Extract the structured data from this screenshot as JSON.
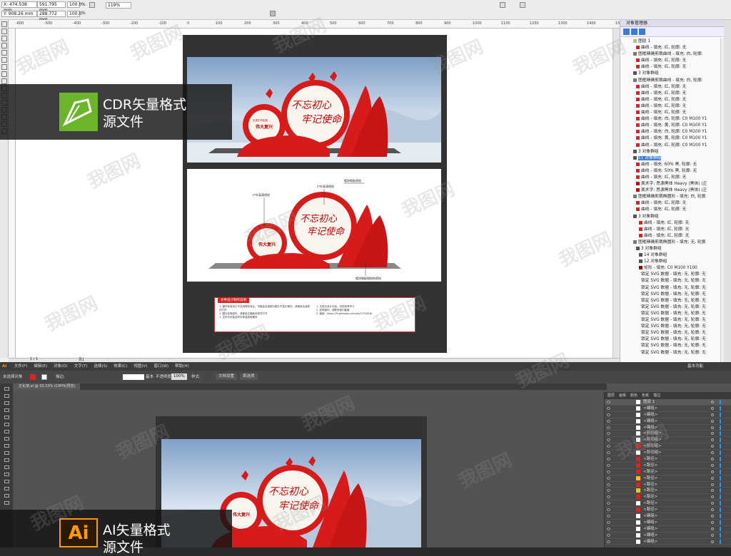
{
  "cdr": {
    "prop_x": "X: 474.538 mm",
    "prop_y": "Y: 908.26 mm",
    "prop_w": "591.795 mm",
    "prop_h": "288.772 mm",
    "scale_w": "100.0",
    "scale_h": "100.0",
    "percent": "%",
    "zoom": "119%",
    "ruler_marks": [
      "-600",
      "-500",
      "-400",
      "-300",
      "-200",
      "-100",
      "0",
      "100",
      "200",
      "300",
      "400",
      "500",
      "600",
      "700",
      "800",
      "900",
      "1000",
      "1100",
      "1200",
      "1300",
      "1400",
      "1500"
    ],
    "page_counter": "1 / 1",
    "page_tab": "页1"
  },
  "obj_panel": {
    "title": "对象管理器",
    "rows": [
      {
        "indent": 4,
        "icon": "folder",
        "text": "图层 1",
        "sel": false
      },
      {
        "indent": 5,
        "icon": "curve",
        "text": "曲线 - 填充: 红, 轮廓: 无",
        "sel": false
      },
      {
        "indent": 4,
        "icon": "clip",
        "text": "图框精确剪裁曲线 - 填充: 白, 轮廓:",
        "sel": false
      },
      {
        "indent": 5,
        "icon": "curve",
        "text": "曲线 - 填充: 红, 轮廓: 无",
        "sel": false
      },
      {
        "indent": 5,
        "icon": "curve",
        "text": "曲线 - 填充: 红, 轮廓: 无",
        "sel": false
      },
      {
        "indent": 4,
        "icon": "group",
        "text": "3 对象群组",
        "sel": false
      },
      {
        "indent": 4,
        "icon": "clip",
        "text": "图框精确剪裁曲线 - 填充: 白, 轮廓:",
        "sel": false
      },
      {
        "indent": 5,
        "icon": "curve",
        "text": "曲线 - 填充: 红, 轮廓: 无",
        "sel": false
      },
      {
        "indent": 5,
        "icon": "curve",
        "text": "曲线 - 填充: 红, 轮廓: 无",
        "sel": false
      },
      {
        "indent": 5,
        "icon": "curve",
        "text": "曲线 - 填充: 红, 轮廓: 无",
        "sel": false
      },
      {
        "indent": 5,
        "icon": "curve",
        "text": "曲线 - 填充: 红, 轮廓: 无",
        "sel": false
      },
      {
        "indent": 5,
        "icon": "curve",
        "text": "曲线 - 填充: 红, 轮廓: 无",
        "sel": false
      },
      {
        "indent": 5,
        "icon": "curve",
        "text": "曲线 - 填充: 白, 轮廓: C0 M100 Y1",
        "sel": false
      },
      {
        "indent": 5,
        "icon": "curve",
        "text": "曲线 - 填充: 黄, 轮廓: C0 M100 Y1",
        "sel": false
      },
      {
        "indent": 5,
        "icon": "curve",
        "text": "曲线 - 填充: 白, 轮廓: C0 M100 Y1",
        "sel": false
      },
      {
        "indent": 5,
        "icon": "curve",
        "text": "曲线 - 填充: 黄, 轮廓: C0 M100 Y1",
        "sel": false
      },
      {
        "indent": 5,
        "icon": "curve",
        "text": "曲线 - 填充: 红, 轮廓: C0 M100 Y1",
        "sel": false
      },
      {
        "indent": 4,
        "icon": "group",
        "text": "3 对象群组",
        "sel": false
      },
      {
        "indent": 4,
        "icon": "group",
        "text": "11 对象群组",
        "sel": true
      },
      {
        "indent": 5,
        "icon": "curve",
        "text": "曲线 - 填充: 60% 黑, 轮廓: 无",
        "sel": false
      },
      {
        "indent": 5,
        "icon": "curve",
        "text": "曲线 - 填充: 50% 黑, 轮廓: 无",
        "sel": false
      },
      {
        "indent": 5,
        "icon": "curve",
        "text": "曲线 - 填充: 红, 轮廓: 无",
        "sel": false
      },
      {
        "indent": 5,
        "icon": "text",
        "text": "美术字: 思源黑体 Heavy (黑体) (正",
        "sel": false
      },
      {
        "indent": 5,
        "icon": "text",
        "text": "美术字: 思源黑体 Heavy (黑体) (正",
        "sel": false
      },
      {
        "indent": 4,
        "icon": "clip",
        "text": "图框精确剪裁椭圆形 - 填充: 白, 轮廓",
        "sel": false
      },
      {
        "indent": 5,
        "icon": "curve",
        "text": "曲线 - 填充: 红, 轮廓: 无",
        "sel": false
      },
      {
        "indent": 5,
        "icon": "curve",
        "text": "曲线 - 填充: 红, 轮廓: 无",
        "sel": false
      },
      {
        "indent": 4,
        "icon": "group",
        "text": "3 对象群组",
        "sel": false
      },
      {
        "indent": 6,
        "icon": "curve",
        "text": "曲线 - 填充: 红, 轮廓: 无",
        "sel": false
      },
      {
        "indent": 6,
        "icon": "curve",
        "text": "曲线 - 填充: 红, 轮廓: 无",
        "sel": false
      },
      {
        "indent": 6,
        "icon": "curve",
        "text": "曲线 - 填充: 红, 轮廓: 无",
        "sel": false
      },
      {
        "indent": 4,
        "icon": "clip",
        "text": "图框精确剪裁椭圆形 - 填充: 无, 轮廓",
        "sel": false
      },
      {
        "indent": 5,
        "icon": "group",
        "text": "3 对象群组",
        "sel": false
      },
      {
        "indent": 6,
        "icon": "group",
        "text": "14 对象群组",
        "sel": false
      },
      {
        "indent": 6,
        "icon": "group",
        "text": "12 对象群组",
        "sel": false
      },
      {
        "indent": 6,
        "icon": "rect",
        "text": "矩形 - 填充: C0 M100 Y100",
        "sel": false
      },
      {
        "indent": 5,
        "icon": "none",
        "text": "锁定 SVG 数据 - 填充: 无, 轮廓: 无",
        "sel": false
      },
      {
        "indent": 5,
        "icon": "none",
        "text": "锁定 SVG 数据 - 填充: 无, 轮廓: 无",
        "sel": false
      },
      {
        "indent": 5,
        "icon": "none",
        "text": "锁定 SVG 数据 - 填充: 无, 轮廓: 无",
        "sel": false
      },
      {
        "indent": 5,
        "icon": "none",
        "text": "锁定 SVG 数据 - 填充: 无, 轮廓: 无",
        "sel": false
      },
      {
        "indent": 5,
        "icon": "none",
        "text": "锁定 SVG 数据 - 填充: 无, 轮廓: 无",
        "sel": false
      },
      {
        "indent": 5,
        "icon": "none",
        "text": "锁定 SVG 数据 - 填充: 无, 轮廓: 无",
        "sel": false
      },
      {
        "indent": 5,
        "icon": "none",
        "text": "锁定 SVG 数据 - 填充: 无, 轮廓: 无",
        "sel": false
      },
      {
        "indent": 5,
        "icon": "none",
        "text": "锁定 SVG 数据 - 填充: 无, 轮廓: 无",
        "sel": false
      },
      {
        "indent": 5,
        "icon": "none",
        "text": "锁定 SVG 数据 - 填充: 无, 轮廓: 无",
        "sel": false
      },
      {
        "indent": 5,
        "icon": "none",
        "text": "锁定 SVG 数据 - 填充: 无, 轮廓: 无",
        "sel": false
      },
      {
        "indent": 5,
        "icon": "none",
        "text": "锁定 SVG 数据 - 填充: 无, 轮廓: 无",
        "sel": false
      },
      {
        "indent": 5,
        "icon": "none",
        "text": "锁定 SVG 数据 - 填充: 无, 轮廓: 无",
        "sel": false
      },
      {
        "indent": 5,
        "icon": "none",
        "text": "锁定 SVG 数据 - 填充: 无, 轮廓: 无",
        "sel": false
      }
    ]
  },
  "banner_cdr": {
    "line1": "CDR矢量格式",
    "line2": "源文件"
  },
  "banner_ai": {
    "line1": "AI矢量格式",
    "line2": "源文件",
    "logo": "Ai"
  },
  "artwork": {
    "slogan_big": "不忘初心",
    "slogan_big2": "牢记使命",
    "slogan_small": "伟大复兴",
    "slogan_small_top": "实现中华民族",
    "callout_1": "户外高清喷绘",
    "callout_2": "户外高清喷绘",
    "callout_3": "镀锌钢板喷绘",
    "callout_4": "镀锌钢板钢结构喷绘",
    "note_title": "文件设计制作说明",
    "note_left": "1. 循环标准设计不支持修改对比，可能会出现部分图片不显示情况，请使用合适软件打开\n2. 图片若有缺失，请使用正确版本软件打开\n3. 文件中可能含有字体或其他素材",
    "note_right": "1. 文档为设计作品，仅供参考学习\n2. 如有疑问，请联系我们客服\n3. 链接：https://fs.wenojoo.com/ed/1374618/"
  },
  "ai": {
    "logo": "Ai",
    "menus": [
      "文件(F)",
      "编辑(E)",
      "对象(O)",
      "文字(T)",
      "选择(S)",
      "效果(C)",
      "视图(V)",
      "窗口(W)",
      "帮助(H)"
    ],
    "workspace": "基本功能",
    "ctrl_label": "未选择对象",
    "stroke_label": "描边:",
    "basic": "基本",
    "opacity_label": "不透明度:",
    "opacity_val": "100%",
    "style_label": "样式:",
    "doc_setup": "文档设置",
    "prefs": "首选项",
    "tab": "文化墙.ai @ 33.33% (CMYK/预览)",
    "layers_tabs": [
      "图层",
      "画板",
      "颜色",
      "色板",
      "描边"
    ],
    "layers": [
      {
        "name": "图层 1",
        "top": true,
        "sw": "#ffffff"
      },
      {
        "name": "<编组>",
        "top": false,
        "sw": "#ffffff"
      },
      {
        "name": "<编组>",
        "top": false,
        "sw": "#ffffff"
      },
      {
        "name": "<编组>",
        "top": false,
        "sw": "#ffffff"
      },
      {
        "name": "<编组>",
        "top": false,
        "sw": "#ffffff"
      },
      {
        "name": "<剪切组>",
        "top": false,
        "sw": "#ffffff"
      },
      {
        "name": "<剪切组>",
        "top": false,
        "sw": "#ffffff"
      },
      {
        "name": "<剪切组>",
        "top": false,
        "sw": "#d22"
      },
      {
        "name": "<剪切组>",
        "top": false,
        "sw": "#ffffff"
      },
      {
        "name": "<路径>",
        "top": false,
        "sw": "#d22"
      },
      {
        "name": "<路径>",
        "top": false,
        "sw": "#d22"
      },
      {
        "name": "<路径>",
        "top": false,
        "sw": "#d22"
      },
      {
        "name": "<路径>",
        "top": false,
        "sw": "#f5c400"
      },
      {
        "name": "<路径>",
        "top": false,
        "sw": "#d22"
      },
      {
        "name": "<路径>",
        "top": false,
        "sw": "#f5c400"
      },
      {
        "name": "<路径>",
        "top": false,
        "sw": "#d22"
      },
      {
        "name": "<路径>",
        "top": false,
        "sw": "#ffffff"
      },
      {
        "name": "<路径>",
        "top": false,
        "sw": "#d22"
      },
      {
        "name": "<编组>",
        "top": false,
        "sw": "#ffffff"
      },
      {
        "name": "<编组>",
        "top": false,
        "sw": "#ffffff"
      },
      {
        "name": "<编组>",
        "top": false,
        "sw": "#ffffff"
      },
      {
        "name": "<编组>",
        "top": false,
        "sw": "#ffffff"
      },
      {
        "name": "<编组>",
        "top": false,
        "sw": "#ffffff"
      }
    ]
  },
  "watermark": "我图网"
}
